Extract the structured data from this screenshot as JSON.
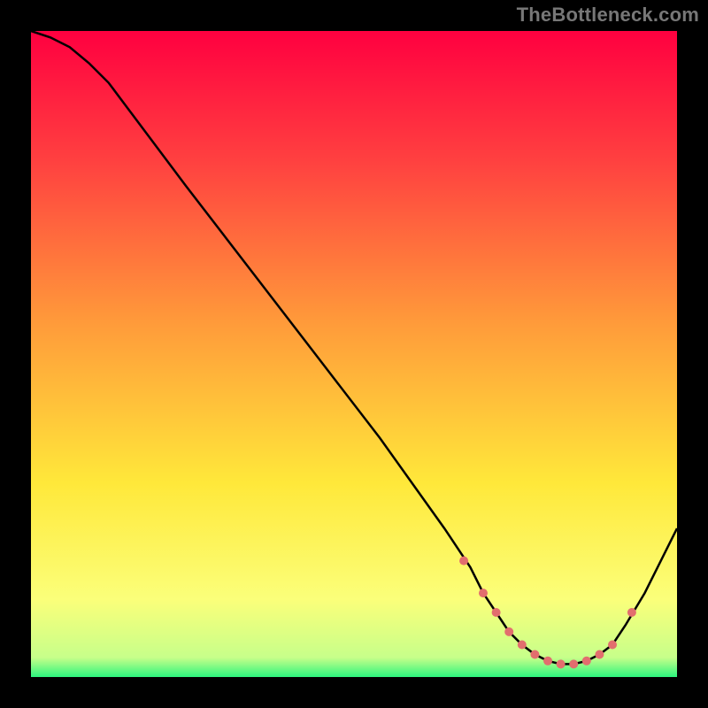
{
  "attribution": "TheBottleneck.com",
  "colors": {
    "page_bg": "#000000",
    "curve": "#000000",
    "markers": "#e26e6e",
    "gradient": [
      {
        "offset": "0%",
        "color": "#ff0040"
      },
      {
        "offset": "20%",
        "color": "#ff4040"
      },
      {
        "offset": "45%",
        "color": "#ff9a3a"
      },
      {
        "offset": "70%",
        "color": "#ffe83a"
      },
      {
        "offset": "88%",
        "color": "#fbff7a"
      },
      {
        "offset": "97%",
        "color": "#c7ff8a"
      },
      {
        "offset": "100%",
        "color": "#2cf57e"
      }
    ]
  },
  "chart_data": {
    "type": "line",
    "title": "",
    "xlabel": "",
    "ylabel": "",
    "xlim": [
      0,
      100
    ],
    "ylim": [
      0,
      100
    ],
    "x": [
      0,
      3,
      6,
      9,
      12,
      15,
      24,
      34,
      44,
      54,
      64,
      68,
      70,
      72,
      74,
      76,
      78,
      80,
      82,
      84,
      86,
      88,
      90,
      92,
      95,
      100
    ],
    "values": [
      100,
      99,
      97.5,
      95,
      92,
      88,
      76,
      63,
      50,
      37,
      23,
      17,
      13,
      10,
      7,
      5,
      3.5,
      2.5,
      2,
      2,
      2.5,
      3.5,
      5,
      8,
      13,
      23
    ],
    "minimum_plateau_x": [
      67,
      70,
      72,
      74,
      76,
      78,
      80,
      82,
      84,
      86,
      88,
      90,
      93
    ],
    "minimum_plateau_y": [
      18,
      13,
      10,
      7,
      5,
      3.5,
      2.5,
      2,
      2,
      2.5,
      3.5,
      5,
      10
    ],
    "marker_radius_px": 5
  }
}
